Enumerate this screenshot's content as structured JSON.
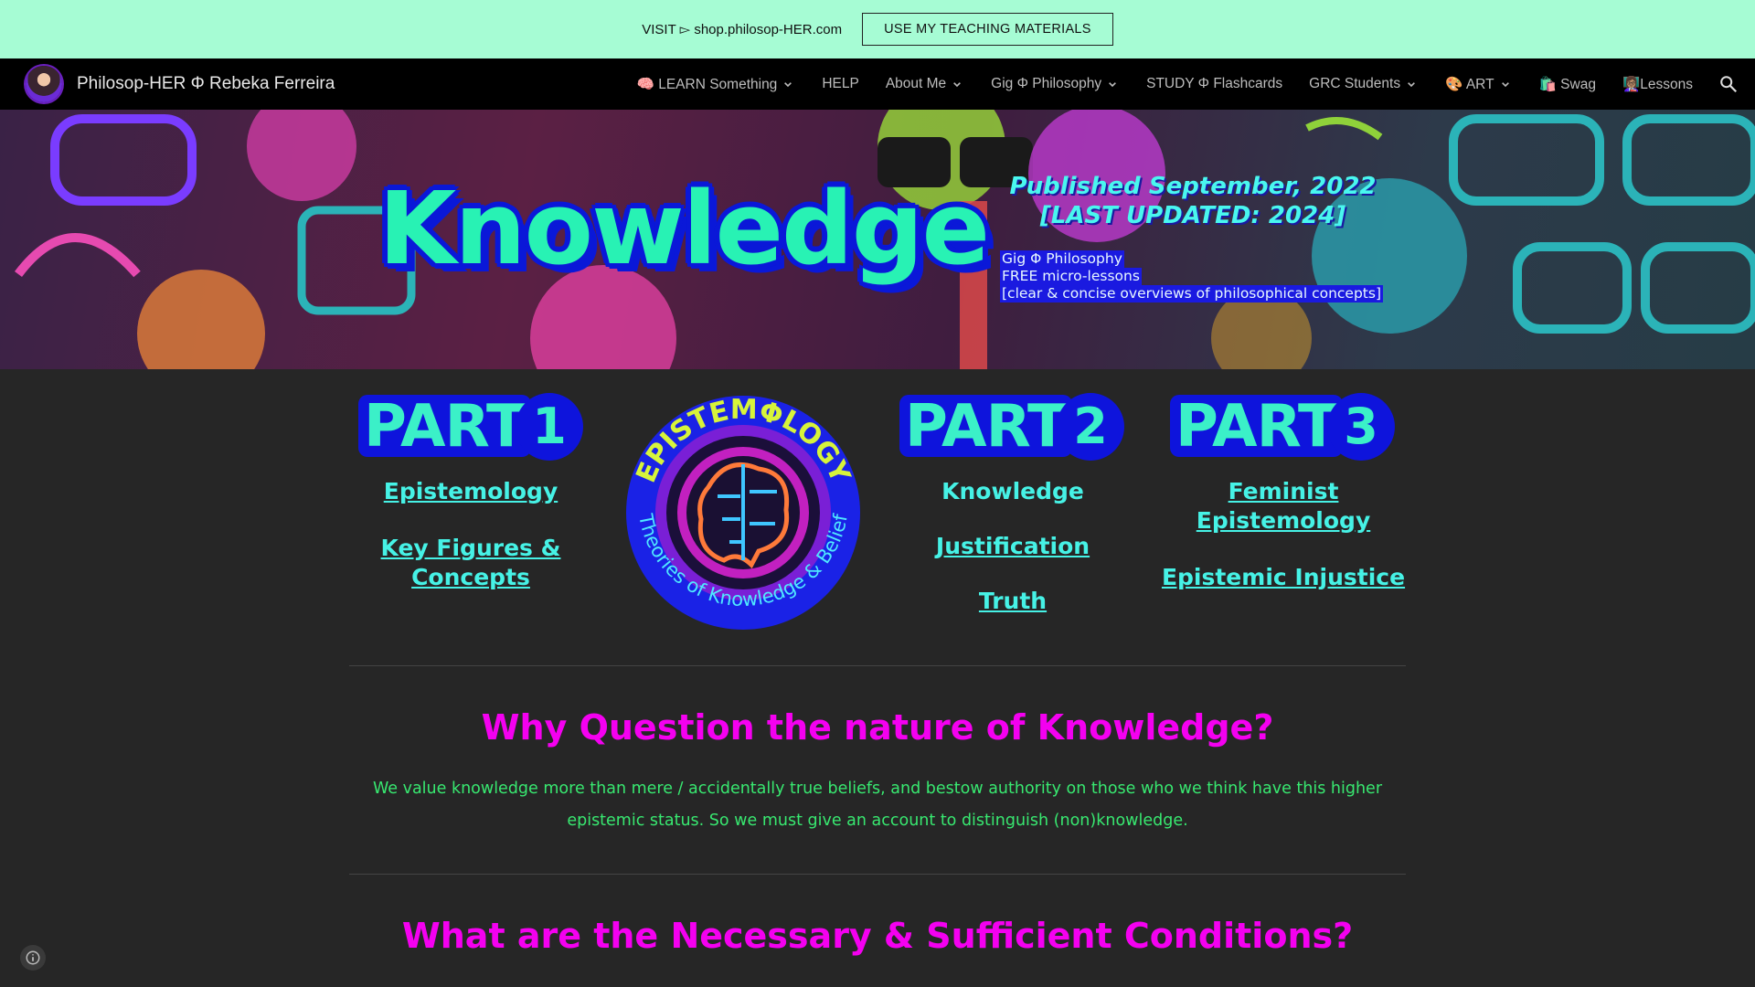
{
  "announcement": {
    "text": "VISIT ▻ shop.philosop-HER.com",
    "button": "USE MY TEACHING MATERIALS"
  },
  "nav": {
    "site_title": "Philosop-HER Φ Rebeka Ferreira",
    "items": [
      {
        "label": "🧠 LEARN Something",
        "dropdown": true
      },
      {
        "label": "HELP",
        "dropdown": false
      },
      {
        "label": "About Me",
        "dropdown": true
      },
      {
        "label": "Gig Φ Philosophy",
        "dropdown": true
      },
      {
        "label": "STUDY Φ Flashcards",
        "dropdown": false
      },
      {
        "label": "GRC Students",
        "dropdown": true
      },
      {
        "label": "🎨 ART",
        "dropdown": true
      },
      {
        "label": "🛍️ Swag",
        "dropdown": false
      },
      {
        "label": "👩🏽‍🏫Lessons",
        "dropdown": false
      }
    ]
  },
  "banner": {
    "title": "Knowledge",
    "published": "Published September, 2022 [LAST UPDATED: 2024]",
    "gig_lines": [
      "Gig Φ Philosophy",
      "FREE micro-lessons",
      "[clear & concise overviews of philosophical concepts]"
    ]
  },
  "parts": [
    {
      "word": "PART",
      "num": "1",
      "links": [
        {
          "label": "Epistemology",
          "link": true
        },
        {
          "label": "Key Figures & Concepts",
          "link": true
        }
      ]
    },
    {
      "word": "PART",
      "num": "2",
      "links": [
        {
          "label": "Knowledge",
          "link": false
        },
        {
          "label": "Justification",
          "link": true
        },
        {
          "label": "Truth",
          "link": true
        }
      ]
    },
    {
      "word": "PART",
      "num": "3",
      "links": [
        {
          "label": "Feminist Epistemology",
          "link": true
        },
        {
          "label": "Epistemic Injustice",
          "link": true
        }
      ]
    }
  ],
  "logo": {
    "top_text": "EPISTEMΦLOGY",
    "bottom_text": "Theories of Knowledge & Belief"
  },
  "sections": [
    {
      "heading": "Why Question the nature of Knowledge?",
      "paragraph": "We value knowledge more than mere / accidentally true beliefs, and bestow authority on those who we think have this higher epistemic status. So we must give an account to distinguish (non)knowledge."
    },
    {
      "heading": "What are the Necessary & Sufficient Conditions?"
    }
  ],
  "colors": {
    "announcement_bg": "#a6fcd4",
    "heading": "#f400f0",
    "paragraph": "#38e870",
    "link": "#46f2e6",
    "badge": "#0e14dc"
  }
}
